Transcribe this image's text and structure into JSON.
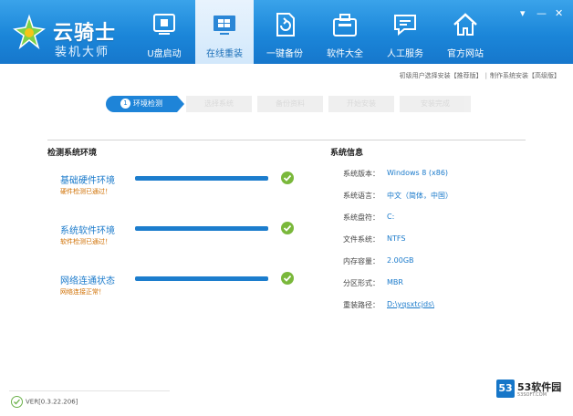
{
  "app": {
    "title": "云骑士",
    "subtitle": "装机大师"
  },
  "nav": [
    {
      "label": "U盘启动",
      "icon": "usb-boot-icon"
    },
    {
      "label": "在线重装",
      "icon": "windows-icon",
      "active": true
    },
    {
      "label": "一键备份",
      "icon": "backup-icon"
    },
    {
      "label": "软件大全",
      "icon": "software-icon"
    },
    {
      "label": "人工服务",
      "icon": "chat-icon"
    },
    {
      "label": "官方网站",
      "icon": "home-icon"
    }
  ],
  "window": {
    "minimize": "▾",
    "min2": "—",
    "close": "✕"
  },
  "links": {
    "left": "初级用户选择安装【推荐版】",
    "right": "制作系统安装【高级版】"
  },
  "steps": [
    {
      "label": "环境检测",
      "active": true
    },
    {
      "label": "选择系统",
      "active": false
    },
    {
      "label": "备份资料",
      "active": false
    },
    {
      "label": "开始安装",
      "active": false
    },
    {
      "label": "安装完成",
      "active": false
    }
  ],
  "env": {
    "title": "检测系统环境",
    "items": [
      {
        "name": "基础硬件环境",
        "status": "硬件检测已通过！",
        "progress": 1.0
      },
      {
        "name": "系统软件环境",
        "status": "软件检测已通过！",
        "progress": 1.0
      },
      {
        "name": "网络连通状态",
        "status": "网络连接正常！",
        "progress": 1.0
      }
    ]
  },
  "sysinfo": {
    "title": "系统信息",
    "rows": [
      {
        "label": "系统版本：",
        "value": "Windows 8 (x86)"
      },
      {
        "label": "系统语言：",
        "value": "中文（简体，中国）"
      },
      {
        "label": "系统盘符：",
        "value": "C:"
      },
      {
        "label": "文件系统：",
        "value": "NTFS"
      },
      {
        "label": "内存容量：",
        "value": "2.00GB"
      },
      {
        "label": "分区形式：",
        "value": "MBR"
      },
      {
        "label": "重装路径：",
        "value": "D:\\yqsxtcjds\\",
        "link": true
      }
    ]
  },
  "footer": {
    "version": "VER[0.3.22.206]"
  },
  "watermark": {
    "brand": "53软件园",
    "badge": "53",
    "url": "53SOFT.COM"
  }
}
